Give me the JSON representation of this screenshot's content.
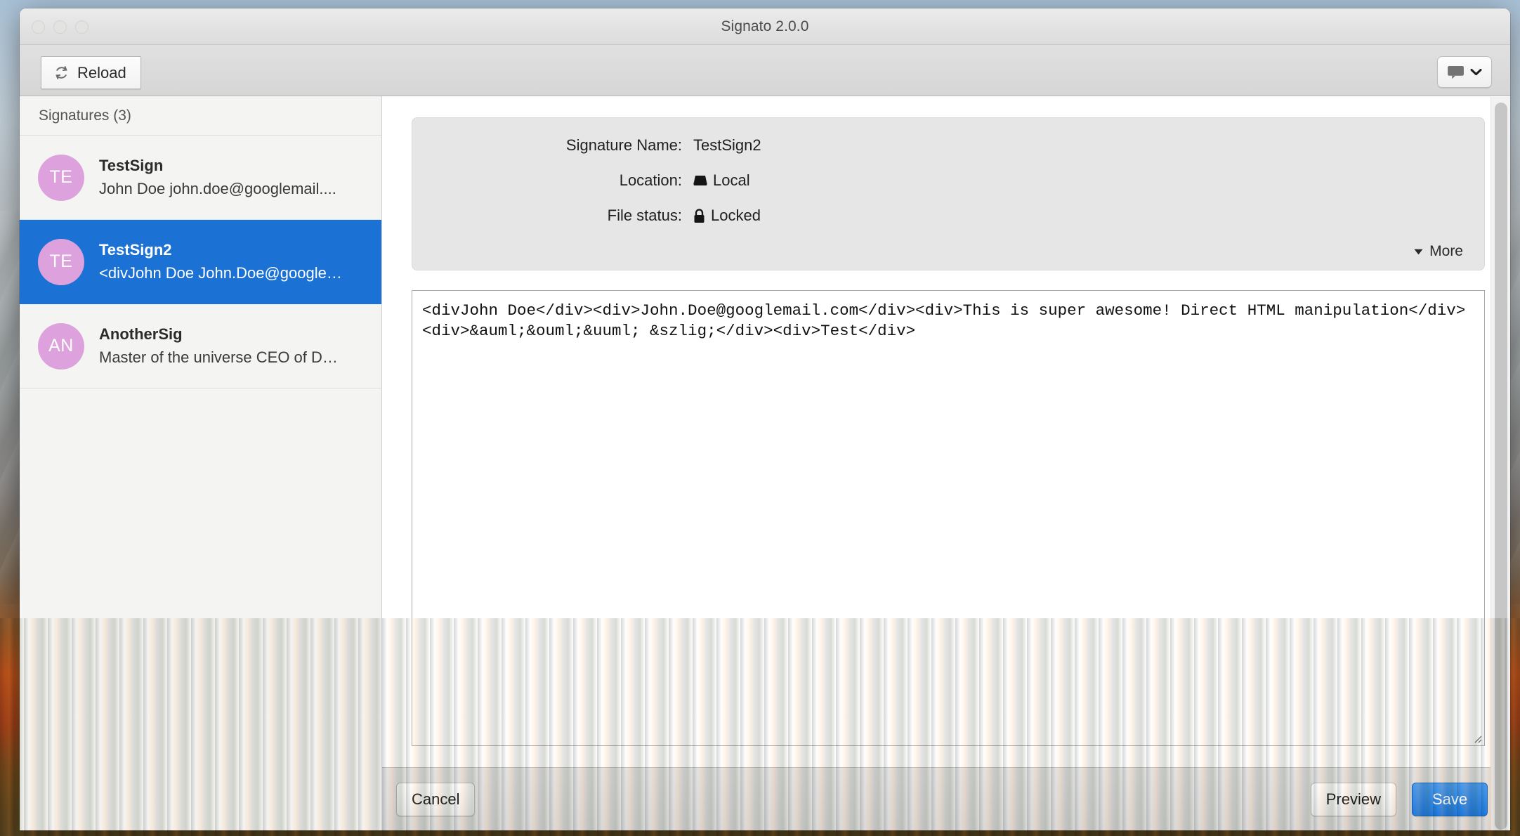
{
  "window": {
    "title": "Signato 2.0.0",
    "traffic_lights": [
      "close-button",
      "minimize-button",
      "zoom-button"
    ]
  },
  "toolbar": {
    "reload_label": "Reload",
    "reload_icon": "refresh-icon",
    "menu_icon": "speech-bubble-icon",
    "menu_chevron_icon": "chevron-down-icon"
  },
  "sidebar": {
    "header": "Signatures (3)",
    "items": [
      {
        "initials": "TE",
        "name": "TestSign",
        "subtitle": "John Doe john.doe@googlemail....",
        "selected": false
      },
      {
        "initials": "TE",
        "name": "TestSign2",
        "subtitle": "<divJohn Doe John.Doe@google…",
        "selected": true
      },
      {
        "initials": "AN",
        "name": "AnotherSig",
        "subtitle": "Master of the universe CEO of D…",
        "selected": false
      }
    ]
  },
  "details": {
    "rows": [
      {
        "label": "Signature Name:",
        "value": "TestSign2",
        "icon": null
      },
      {
        "label": "Location:",
        "value": "Local",
        "icon": "hard-drive-icon"
      },
      {
        "label": "File status:",
        "value": "Locked",
        "icon": "lock-icon"
      }
    ],
    "more_label": "More",
    "more_caret_icon": "caret-down-icon"
  },
  "editor": {
    "content": "<divJohn Doe</div><div>John.Doe@googlemail.com</div><div>This is super awesome! Direct HTML manipulation</div><div>&auml;&ouml;&uuml; &szlig;</div><div>Test</div>"
  },
  "footer": {
    "cancel_label": "Cancel",
    "preview_label": "Preview",
    "save_label": "Save"
  },
  "colors": {
    "accent_blue": "#1b72d4",
    "save_blue": "#1f7ae0",
    "avatar_pink": "#dda2dd",
    "info_card_grey": "#e6e6e6"
  }
}
